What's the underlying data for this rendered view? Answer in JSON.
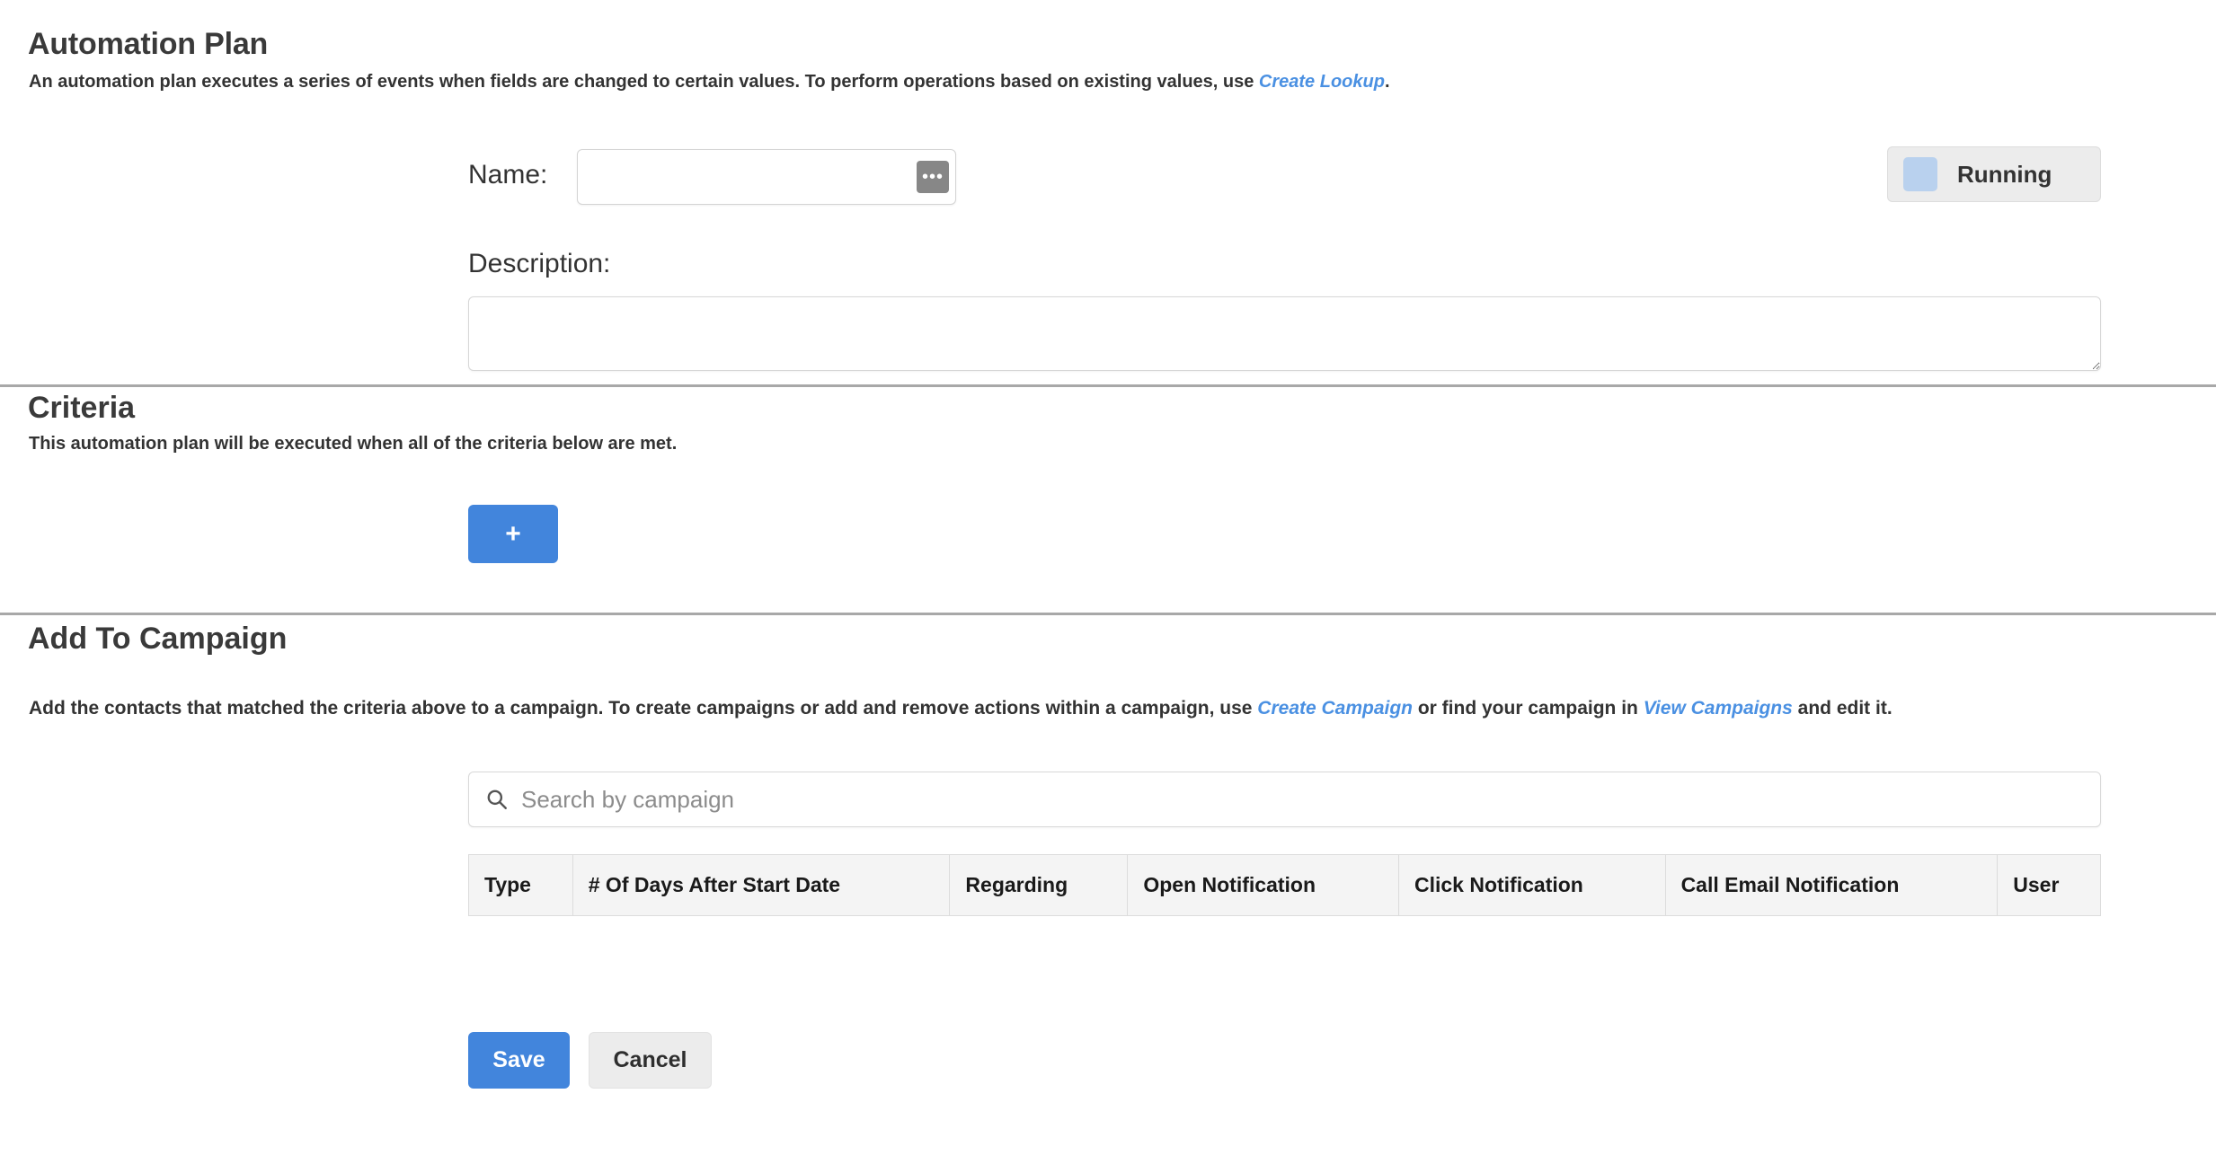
{
  "header": {
    "title": "Automation Plan",
    "description_before": "An automation plan executes a series of events when fields are changed to certain values. To perform operations based on existing values, use ",
    "description_link": "Create Lookup",
    "description_after": "."
  },
  "form": {
    "name_label": "Name:",
    "name_value": "",
    "name_placeholder": "",
    "name_lookup_button": "•••",
    "description_label": "Description:",
    "description_value": "",
    "description_placeholder": ""
  },
  "status": {
    "label": "Running",
    "swatch_color": "#b9d1ee",
    "badge_bg": "#ececec"
  },
  "criteria": {
    "title": "Criteria",
    "description": "This automation plan will be executed when all of the criteria below are met.",
    "add_button_label": "+"
  },
  "campaign": {
    "title": "Add To Campaign",
    "description_part1": "Add the contacts that matched the criteria above to a campaign. To create campaigns or add and remove actions within a campaign, use ",
    "link_create": "Create Campaign",
    "description_part2": " or find your campaign in ",
    "link_view": "View Campaigns",
    "description_part3": " and edit it.",
    "search_placeholder": "Search by campaign",
    "search_value": "",
    "search_icon": "search-icon",
    "table": {
      "columns": [
        "Type",
        "# Of Days After Start Date",
        "Regarding",
        "Open Notification",
        "Click Notification",
        "Call Email Notification",
        "User"
      ],
      "rows": []
    }
  },
  "footer": {
    "save_label": "Save",
    "cancel_label": "Cancel"
  },
  "colors": {
    "accent_blue": "#4285dc",
    "link_blue": "#4a90e2",
    "divider": "#a8a8a8",
    "table_header_bg": "#f4f4f4"
  }
}
